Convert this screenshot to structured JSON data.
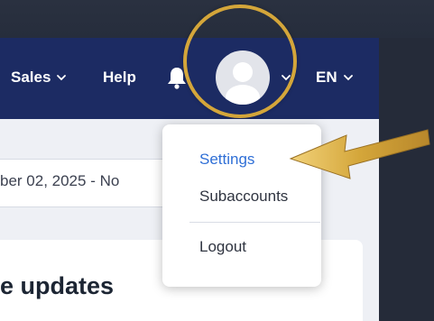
{
  "nav": {
    "items": [
      {
        "label": "Sales"
      },
      {
        "label": "Help"
      }
    ],
    "language": "EN"
  },
  "toolbar": {
    "date_range": "ber 02, 2025 - No"
  },
  "dropdown": {
    "items": [
      {
        "label": "Settings"
      },
      {
        "label": "Subaccounts"
      },
      {
        "label": "Logout"
      }
    ]
  },
  "card": {
    "title": "e updates"
  },
  "colors": {
    "navbar": "#1c2b63",
    "highlight": "#d4a63a",
    "settings_link": "#2f6fd6"
  }
}
